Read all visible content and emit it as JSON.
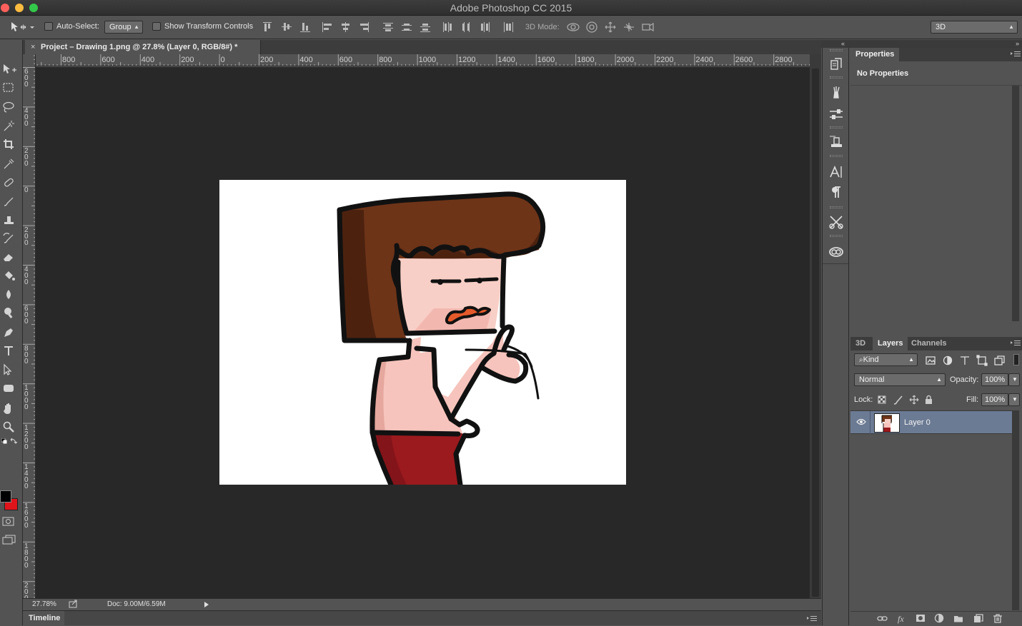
{
  "window": {
    "title": "Adobe Photoshop CC 2015"
  },
  "options_bar": {
    "auto_select_label": "Auto-Select:",
    "auto_select_value": "Group",
    "show_transform_label": "Show Transform Controls",
    "mode_3d_label": "3D Mode:",
    "workspace_value": "3D"
  },
  "document": {
    "tab_title": "Project – Drawing 1.png @ 27.8% (Layer 0, RGB/8#) *",
    "tab_close": "×"
  },
  "rulers": {
    "top_labels": [
      "800",
      "600",
      "400",
      "200",
      "0",
      "200",
      "400",
      "600",
      "800",
      "1000",
      "1200",
      "1400",
      "1600",
      "1800",
      "2000",
      "2200",
      "2400",
      "2600",
      "2800"
    ],
    "left_labels": [
      "600",
      "400",
      "200",
      "0",
      "200",
      "400",
      "600",
      "800",
      "1000",
      "1200",
      "1400",
      "1600",
      "1800",
      "2000"
    ]
  },
  "status": {
    "zoom": "27.78%",
    "doc_size": "Doc: 9.00M/6.59M"
  },
  "timeline": {
    "label": "Timeline"
  },
  "properties_panel": {
    "tab_label": "Properties",
    "empty_text": "No Properties"
  },
  "layers_panel": {
    "tabs": [
      "3D",
      "Layers",
      "Channels"
    ],
    "active_tab": "Layers",
    "filter_kind": "Kind",
    "blend_mode": "Normal",
    "opacity_label": "Opacity:",
    "opacity_value": "100%",
    "lock_label": "Lock:",
    "fill_label": "Fill:",
    "fill_value": "100%",
    "layers": [
      {
        "name": "Layer 0",
        "visible": true
      }
    ]
  },
  "colors": {
    "foreground": "#000000",
    "background": "#e0141b",
    "selected_layer": "#6c7b94",
    "canvas_bg": "#282828"
  }
}
